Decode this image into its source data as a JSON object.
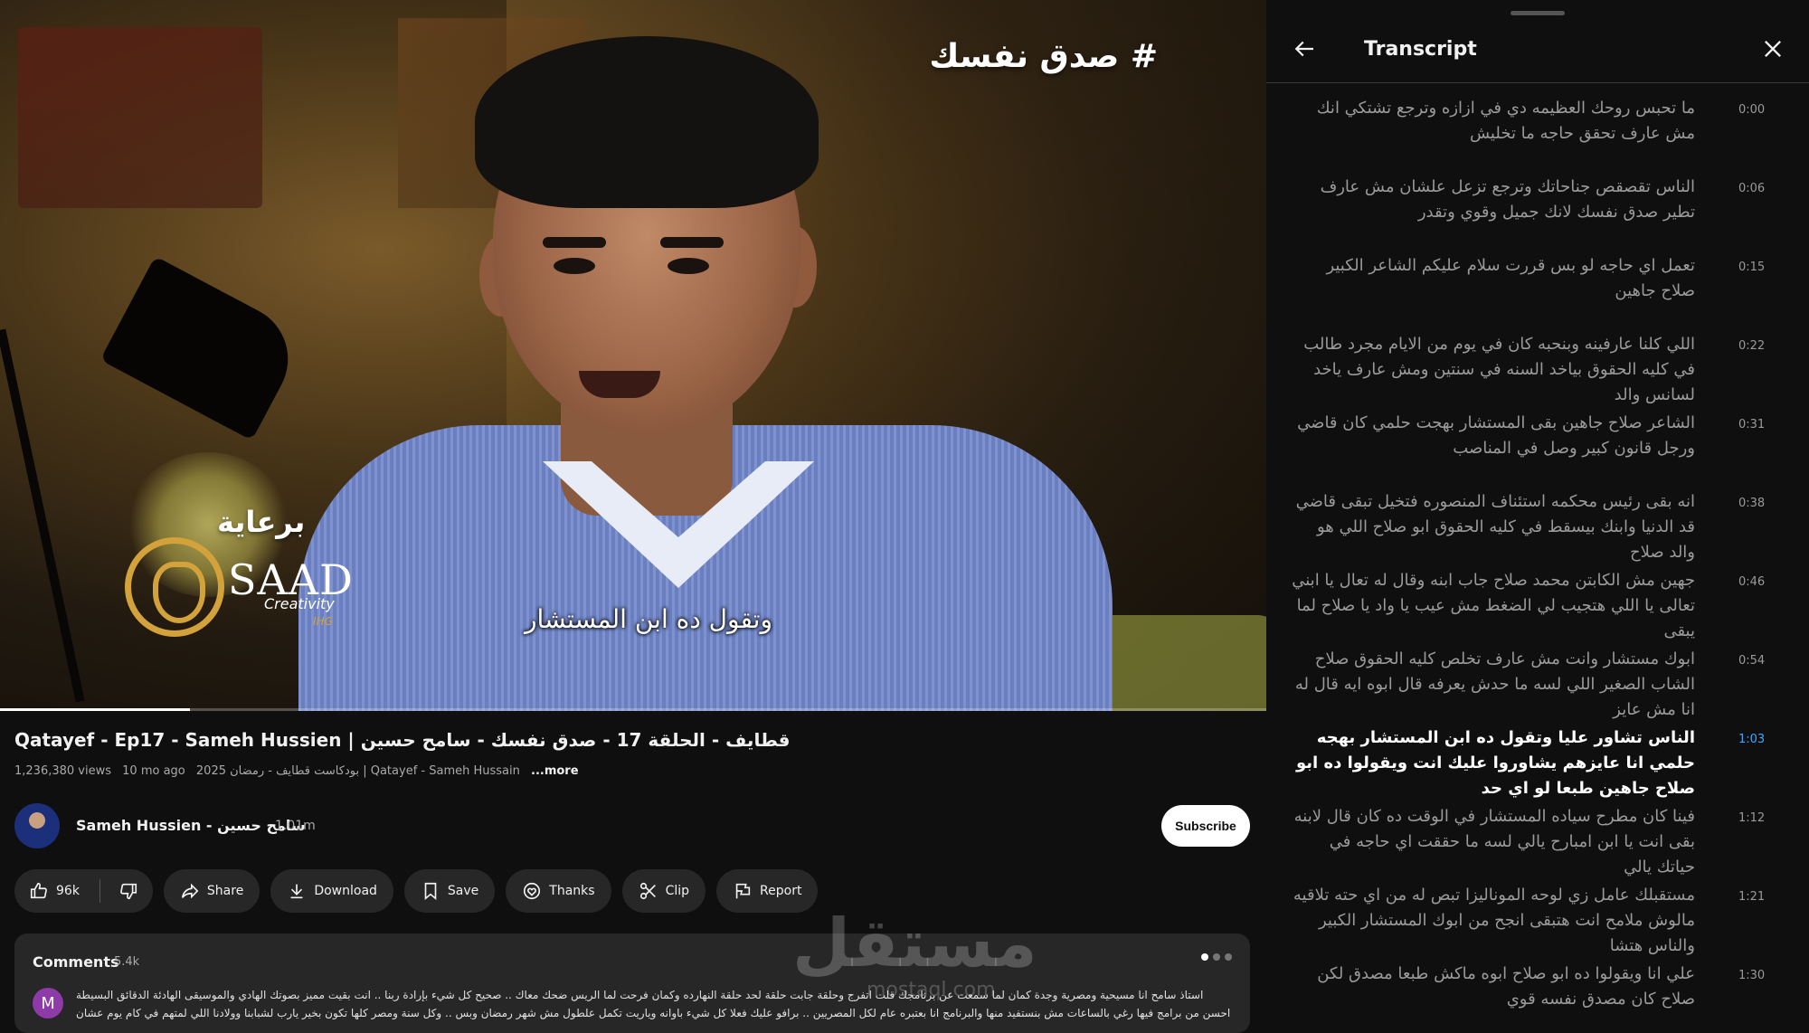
{
  "video": {
    "hashtag": "# صدق نفسك",
    "sponsor_label": "برعاية",
    "brand_name": "SAAD",
    "brand_sub": "Creativity",
    "brand_tag": "IHG",
    "caption": "وتقول ده ابن المستشار",
    "progress": 0.15
  },
  "details": {
    "title": "Qatayef - Ep17 - Sameh Hussien | قطايف - الحلقة 17 - صدق نفسك - سامح حسين",
    "views": "1,236,380 views",
    "age": "10 mo ago",
    "tags": "2025 بودكاست قطايف - رمضان | Qatayef - Sameh Hussain",
    "more": "...more"
  },
  "channel": {
    "name": "Sameh Hussien - سامح حسين",
    "subscribers": "1.01m",
    "subscribe_label": "Subscribe"
  },
  "actions": {
    "likes": "96k",
    "share": "Share",
    "download": "Download",
    "save": "Save",
    "thanks": "Thanks",
    "clip": "Clip",
    "report": "Report"
  },
  "comments": {
    "title": "Comments",
    "count": "5.4k",
    "avatar_letter": "M",
    "first_comment": "استاذ سامح انا مسيحية ومصرية وجدة كمان لما سمعت عن برنامجك قلت اتفرج وحلقة جابت حلقة لحد حلقة النهارده وكمان فرحت لما الريس ضحك معاك .. صحيح كل شيء بإرادة ربنا .. انت بقيت مميز بصوتك الهادي والموسيقى الهادئة الدقائق البسيطة احسن من برامج فيها رغي بالساعات مش بنستفيد منها والبرنامج انا بعتبره عام لكل المصريين .. برافو عليك فعلا كل شيء باوانه وياريت تكمل علطول مش شهر رمضان وبس .. وكل سنة ومصر كلها تكون بخير يارب لشبابنا وولادنا اللي لمتهم في كام يوم عشان نسمع كلام حكيم..."
  },
  "watermark": {
    "text": "مستقل",
    "sub": "mostaql.com"
  },
  "transcript": {
    "title": "Transcript",
    "segments": [
      {
        "time": "0:00",
        "text": "ما تحبس روحك العظيمه دي في ازازه وترجع تشتكي انك مش عارف تحقق حاجه ما تخليش"
      },
      {
        "time": "0:06",
        "text": "الناس تقصقص جناحاتك وترجع تزعل علشان مش عارف تطير صدق نفسك لانك جميل وقوي وتقدر"
      },
      {
        "time": "0:15",
        "text": "تعمل اي حاجه لو بس قررت سلام عليكم الشاعر الكبير صلاح جاهين"
      },
      {
        "time": "0:22",
        "text": "اللي كلنا عارفينه وبنحبه كان في يوم من الايام مجرد طالب في كليه الحقوق بياخد السنه في سنتين ومش عارف ياخد لسانس والد"
      },
      {
        "time": "0:31",
        "text": "الشاعر صلاح جاهين بقى المستشار بهجت حلمي كان قاضي ورجل قانون كبير وصل في المناصب"
      },
      {
        "time": "0:38",
        "text": "انه بقى رئيس محكمه استئناف المنصوره فتخيل تبقى قاضي قد الدنيا وابنك بيسقط في كليه الحقوق ابو صلاح اللي هو والد صلاح"
      },
      {
        "time": "0:46",
        "text": "جهين مش الكابتن محمد صلاح جاب ابنه وقال له تعال يا ابني تعالى يا اللي هتجيب لي الضغط مش عيب يا واد يا صلاح لما يبقى"
      },
      {
        "time": "0:54",
        "text": "ابوك مستشار وانت مش عارف تخلص كليه الحقوق صلاح الشاب الصغير اللي لسه ما حدش يعرفه قال ابوه ايه قال له انا مش عايز"
      },
      {
        "time": "1:03",
        "text": "الناس تشاور عليا وتقول ده ابن المستشار بهجه حلمي انا عايزهم يشاوروا عليك انت ويقولوا ده ابو صلاح جاهين طبعا لو اي حد",
        "active": true
      },
      {
        "time": "1:12",
        "text": "فينا كان مطرح سياده المستشار في الوقت ده كان قال لابنه بقى انت يا ابن امبارح يالي لسه ما حققت اي حاجه في حياتك يالي"
      },
      {
        "time": "1:21",
        "text": "مستقبلك عامل زي لوحه الموناليزا تبص له من اي حته تلاقيه مالوش ملامح انت هتبقى انجح من ابوك المستشار الكبير والناس هتشا"
      },
      {
        "time": "1:30",
        "text": "علي انا ويقولوا ده ابو صلاح ابوه ماكش طبعا مصدق لكن صلاح كان مصدق نفسه قوي"
      }
    ]
  }
}
